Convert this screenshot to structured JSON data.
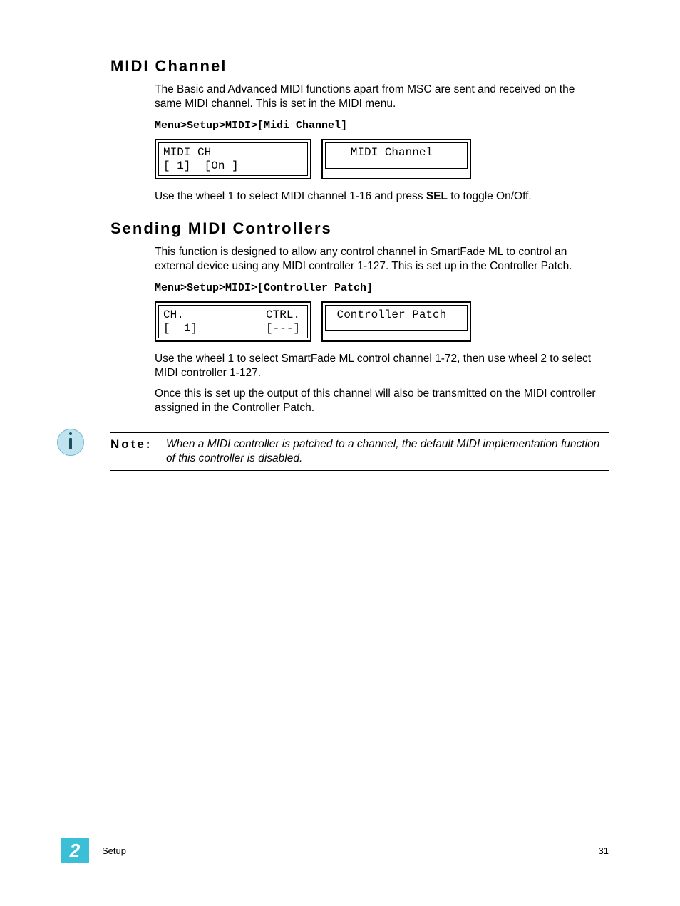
{
  "section1": {
    "heading": "MIDI Channel",
    "para1": "The Basic and Advanced MIDI functions apart from MSC are sent and received on the same MIDI channel. This is set in the MIDI menu.",
    "menu_path": "Menu>Setup>MIDI>[Midi Channel]",
    "lcd_left": "MIDI CH\n[ 1]  [On ]",
    "lcd_right": "   MIDI Channel",
    "instr_pre": "Use the wheel 1 to select MIDI channel 1-16 and press ",
    "instr_bold": "SEL",
    "instr_post": " to toggle On/Off."
  },
  "section2": {
    "heading": "Sending MIDI Controllers",
    "para1": "This function is designed to allow any control channel in SmartFade ML to control an external device using any MIDI controller 1-127. This is set up in the Controller Patch.",
    "menu_path": "Menu>Setup>MIDI>[Controller Patch]",
    "lcd_left": "CH.            CTRL.\n[  1]          [---]",
    "lcd_right": " Controller Patch",
    "para2": "Use the wheel 1 to select SmartFade ML control channel 1-72, then use wheel 2 to select MIDI controller 1-127.",
    "para3": "Once this is set up the output of this channel will also be transmitted on the MIDI controller assigned in the Controller Patch."
  },
  "note": {
    "label": "Note:",
    "text": "When a MIDI controller is patched to a channel, the default MIDI implementation function of this controller is disabled."
  },
  "footer": {
    "chapter": "2",
    "label": "Setup",
    "page": "31"
  }
}
